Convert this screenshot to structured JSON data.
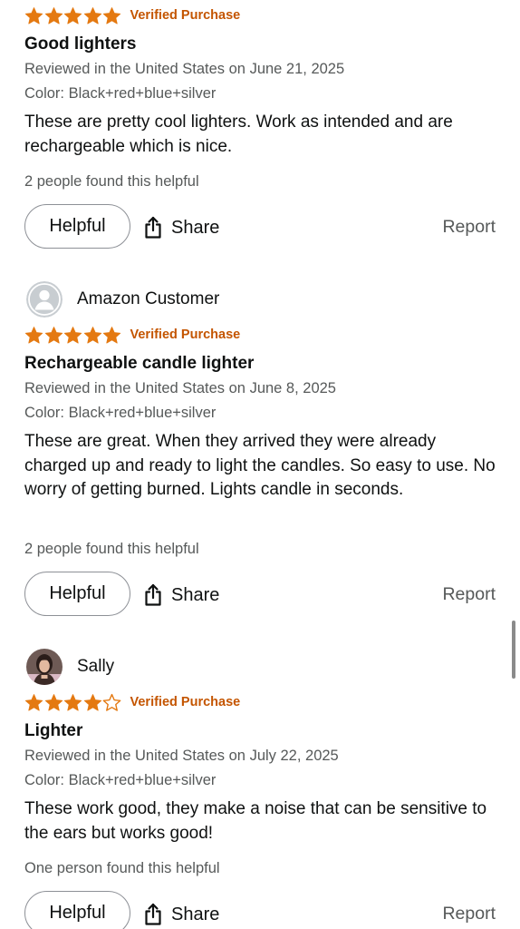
{
  "colors": {
    "star": "#e47911",
    "verified": "#c45500",
    "text": "#0f1111",
    "secondary_text": "#565959",
    "button_border": "#8d9096"
  },
  "reviews": [
    {
      "reviewer": "",
      "avatar": "none",
      "rating": 5,
      "verified_label": "Verified Purchase",
      "title": "Good lighters",
      "reviewed_line": "Reviewed in the United States on June 21, 2025",
      "color_line": "Color: Black+red+blue+silver",
      "body": "These are pretty cool lighters. Work as intended and are rechargeable which is nice.",
      "helpful_count": "2 people found this helpful",
      "helpful_label": "Helpful",
      "share_label": "Share",
      "report_label": "Report"
    },
    {
      "reviewer": "Amazon Customer",
      "avatar": "default-user-avatar",
      "rating": 5,
      "verified_label": "Verified Purchase",
      "title": "Rechargeable candle lighter",
      "reviewed_line": "Reviewed in the United States on June 8, 2025",
      "color_line": "Color: Black+red+blue+silver",
      "body": "These are great. When they arrived they were already charged up and ready to light the candles. So easy to use. No worry of getting burned. Lights candle in seconds.",
      "helpful_count": "2 people found this helpful",
      "helpful_label": "Helpful",
      "share_label": "Share",
      "report_label": "Report"
    },
    {
      "reviewer": "Sally",
      "avatar": "photo-avatar",
      "rating": 4,
      "verified_label": "Verified Purchase",
      "title": "Lighter",
      "reviewed_line": "Reviewed in the United States on July 22, 2025",
      "color_line": "Color: Black+red+blue+silver",
      "body": "These work good, they make a noise that can be sensitive to the ears but works good!",
      "helpful_count": "One person found this helpful",
      "helpful_label": "Helpful",
      "share_label": "Share",
      "report_label": "Report"
    }
  ]
}
